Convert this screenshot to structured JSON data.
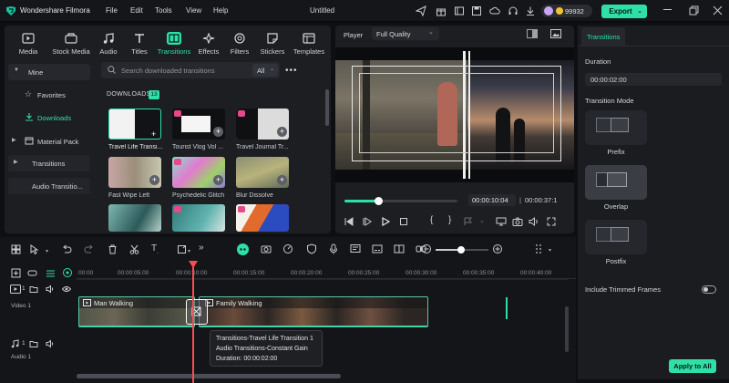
{
  "app": {
    "name": "Wondershare Filmora",
    "project_title": "Untitled",
    "menu": [
      "File",
      "Edit",
      "Tools",
      "View",
      "Help"
    ],
    "credits": "99932",
    "export_label": "Export"
  },
  "media_tabs": [
    {
      "label": "Media",
      "icon": "media-icon"
    },
    {
      "label": "Stock Media",
      "icon": "stock-media-icon"
    },
    {
      "label": "Audio",
      "icon": "audio-icon"
    },
    {
      "label": "Titles",
      "icon": "titles-icon"
    },
    {
      "label": "Transitions",
      "icon": "transitions-icon",
      "active": true
    },
    {
      "label": "Effects",
      "icon": "effects-icon"
    },
    {
      "label": "Filters",
      "icon": "filters-icon"
    },
    {
      "label": "Stickers",
      "icon": "stickers-icon"
    },
    {
      "label": "Templates",
      "icon": "templates-icon"
    }
  ],
  "sidebar": {
    "mine": "Mine",
    "favorites": "Favorites",
    "downloads": "Downloads",
    "material_pack": "Material Pack",
    "transitions": "Transitions",
    "audio_transitions": "Audio Transitio..."
  },
  "library": {
    "search_placeholder": "Search downloaded transitions",
    "filter_value": "All",
    "section_title": "DOWNLOADS",
    "section_count": "13",
    "items": [
      {
        "label": "Travel Life Transi..."
      },
      {
        "label": "Tourist Vlog Vol ..."
      },
      {
        "label": "Travel Journal Tr..."
      },
      {
        "label": "Fast Wipe Left"
      },
      {
        "label": "Psychedelic Glitch"
      },
      {
        "label": "Blur Dissolve"
      },
      {
        "label": ""
      },
      {
        "label": ""
      },
      {
        "label": ""
      }
    ]
  },
  "player": {
    "label": "Player",
    "quality": "Full Quality",
    "current_time": "00:00:10:04",
    "total_time": "00:00:37:1",
    "progress": 0.3
  },
  "properties": {
    "tab": "Transitions",
    "duration_label": "Duration",
    "duration_value": "00:00:02:00",
    "mode_label": "Transition Mode",
    "modes": [
      {
        "label": "Prefix"
      },
      {
        "label": "Overlap",
        "selected": true
      },
      {
        "label": "Postfix"
      }
    ],
    "include_trimmed": "Include Trimmed Frames",
    "include_trimmed_on": false,
    "apply_all": "Apply to All"
  },
  "timeline": {
    "ruler": [
      "00:00",
      "00:00:05:00",
      "00:00:10:00",
      "00:00:15:00",
      "00:00:20:00",
      "00:00:25:00",
      "00:00:30:00",
      "00:00:35:00",
      "00:00:40:00"
    ],
    "video_track": "Video 1",
    "audio_track": "Audio 1",
    "video_track_number": "1",
    "audio_track_number": "1",
    "clip1": "Man Walking",
    "clip2": "Family Walking",
    "tooltip": [
      "Transitions-Travel Life Transition 1",
      "Audio Transitions-Constant Gain",
      "Duration: 00:00:02:00"
    ]
  }
}
